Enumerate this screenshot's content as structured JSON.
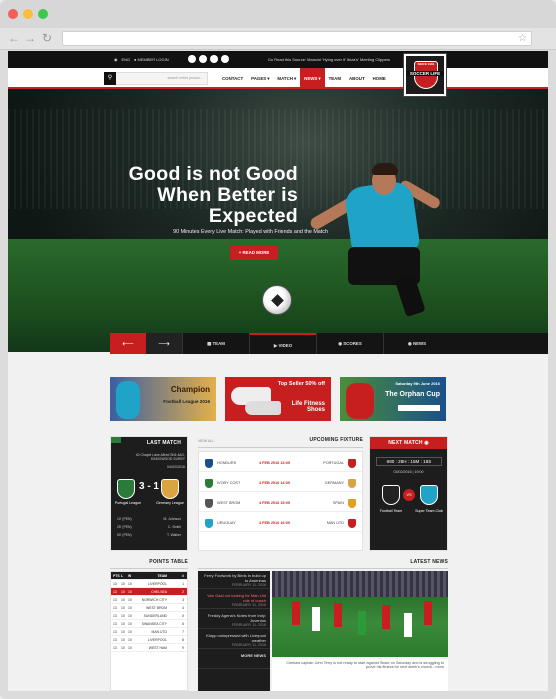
{
  "browser": {
    "title_dots": [
      "#f25f58",
      "#fbbe3b",
      "#3cc84a"
    ]
  },
  "site": {
    "topbar": {
      "language": "ENG",
      "login": "MEMBER LOGIN",
      "ticker": "Go Read this Source: Mancini 'Hying over it' Ibiza's' Meeting Clippers"
    },
    "logo": {
      "line1": "SINCE 1984",
      "line2": "SOCCER LIFE"
    },
    "nav": [
      "HOME",
      "ABOUT",
      "TEAM",
      "NEWS",
      "MATCH",
      "PAGES",
      "CONTACT"
    ],
    "nav_active": "NEWS",
    "search_placeholder": "search entire prosoc...",
    "hero": {
      "title": "Good is not Good When Better is Expected",
      "subtitle": "90 Minutes Every Live Match: Played with Friends and the Match",
      "button": "+ READ MORE",
      "tabs": [
        "NEWS",
        "SCORES",
        "VIDEO",
        "TEAM"
      ]
    },
    "promos": [
      {
        "text": "Champion",
        "sub": "Football League 2016",
        "bg": "#d9a441"
      },
      {
        "text": "Top Seller 50% off",
        "sub": "Life Fitness Shoes",
        "bg": "#c71f1f"
      },
      {
        "text": "Saturday 9th June 2016",
        "sub": "The Orphan Cup",
        "bg": "#1a4f8a"
      }
    ],
    "next_match": {
      "title": "NEXT MATCH",
      "countdown": "680 : 28H : 15M : 18S",
      "time": "03/02/2016 | 19:00",
      "team_a": "Football Team",
      "team_b": "Super Team Club",
      "vs": "VS"
    },
    "upcoming": {
      "title": "UPCOMING FIXTURE",
      "view_all": "VIEW ALL",
      "rows": [
        {
          "home": "PORTUGAL",
          "date": "4 FEB 2016 13:00",
          "away": "HONDURS"
        },
        {
          "home": "GERMANY",
          "date": "4 FEB 2016 14:00",
          "away": "IVORY COST"
        },
        {
          "home": "SPAIN",
          "date": "4 FEB 2016 15:00",
          "away": "WEST BROM"
        },
        {
          "home": "MAN UTD",
          "date": "4 FEB 2016 16:00",
          "away": "URUGUAY"
        }
      ]
    },
    "last_match": {
      "title": "LAST MATCH",
      "league": "40 Chapel Lane Alfred Sh6 4AG, KINGSWOOD SUREY",
      "date": "04/02/2016",
      "score": "3 - 1",
      "team_a": "Germany League",
      "team_b": "Portugal League",
      "scorers": [
        {
          "name": "M. Johnson",
          "min": "10' (PEN)"
        },
        {
          "name": "C. Smith",
          "min": "25' (PEN)"
        },
        {
          "name": "T. Walker",
          "min": "50' (PEN)"
        }
      ]
    },
    "points_table": {
      "title": "POINTS TABLE",
      "headers": [
        "#",
        "TEAM",
        "W",
        "L",
        "PTS"
      ],
      "rows": [
        {
          "n": "1",
          "team": "LIVERPOOL",
          "w": "10",
          "l": "10",
          "p": "13"
        },
        {
          "n": "2",
          "team": "CHELSEA",
          "w": "10",
          "l": "10",
          "p": "13"
        },
        {
          "n": "3",
          "team": "NORWICH CITY",
          "w": "10",
          "l": "10",
          "p": "13"
        },
        {
          "n": "4",
          "team": "WEST BROM",
          "w": "10",
          "l": "10",
          "p": "13"
        },
        {
          "n": "5",
          "team": "SUNDERLAND",
          "w": "10",
          "l": "10",
          "p": "13"
        },
        {
          "n": "6",
          "team": "SWANSEA CITY",
          "w": "10",
          "l": "10",
          "p": "13"
        },
        {
          "n": "7",
          "team": "MAN UTD",
          "w": "10",
          "l": "10",
          "p": "13"
        },
        {
          "n": "8",
          "team": "LIVERPOOL",
          "w": "10",
          "l": "10",
          "p": "13"
        },
        {
          "n": "9",
          "team": "WEST HAM",
          "w": "10",
          "l": "10",
          "p": "13"
        }
      ]
    },
    "latest_news": {
      "title": "LATEST NEWS",
      "items": [
        {
          "title": "Ferry Footwork by Birds in build up to Arsenhas",
          "date": "FEBRUARY 11, 2016"
        },
        {
          "title": "Van Gaal not looking for Man Utd role of coach",
          "date": "FEBRUARY 11, 2016"
        },
        {
          "title": "Freddy Agena's Notes from Indy: Juventus",
          "date": "FEBRUARY 11, 2016"
        },
        {
          "title": "Klopp unimpressed with Liverpool weather",
          "date": "FEBRUARY 11, 2016"
        },
        {
          "title": "MORE NEWS",
          "date": ""
        }
      ],
      "caption": "Chelsea captain John Terry is not ready to start against Stoke on Saturday and is struggling to prove his fitness for next week's crunch...more"
    }
  }
}
